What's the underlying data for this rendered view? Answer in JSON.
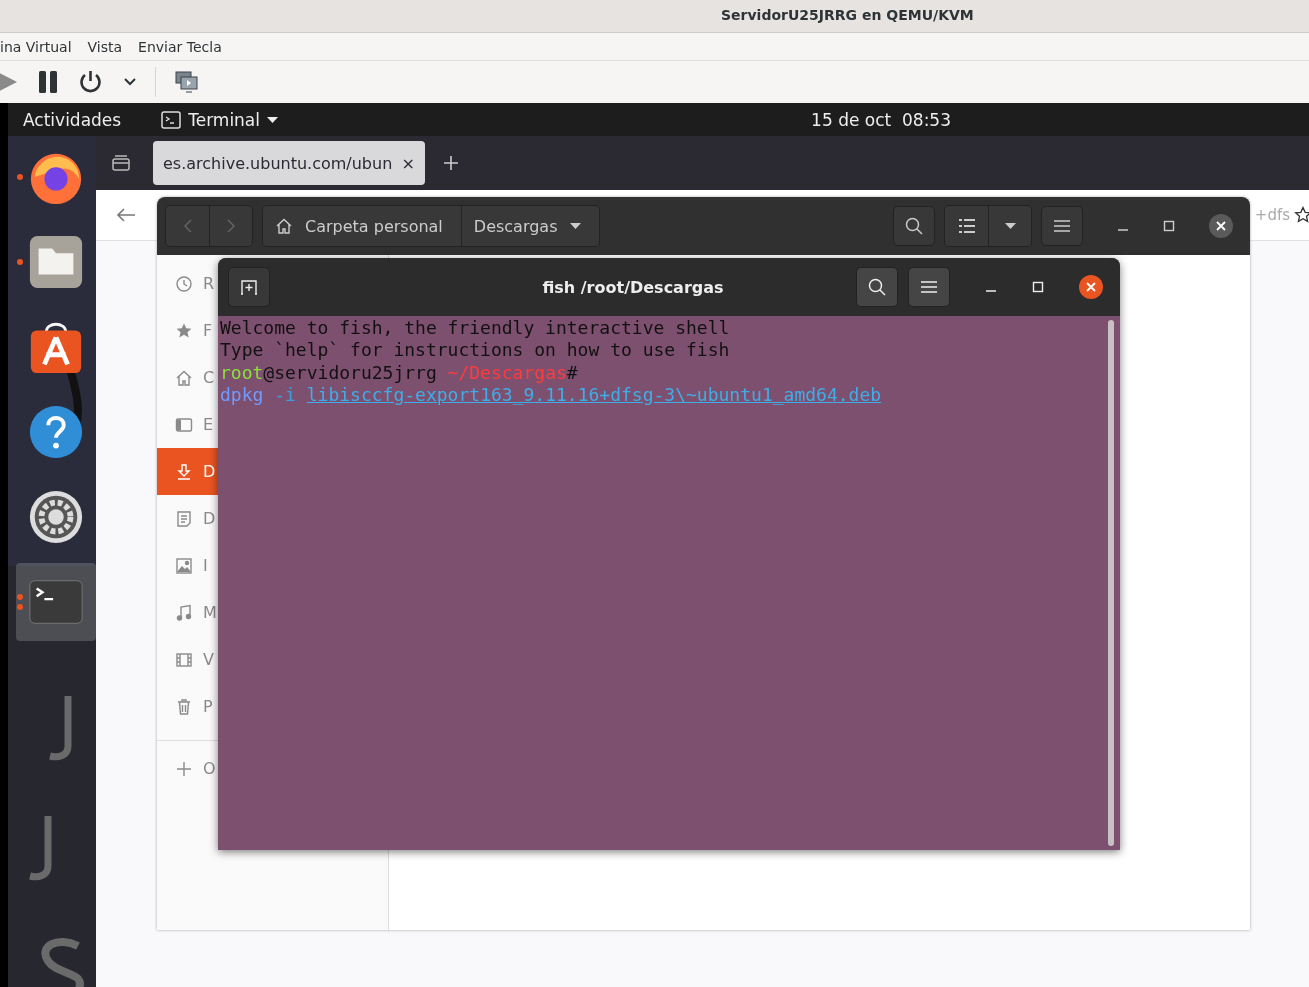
{
  "host_window": {
    "title": "ServidorU25JRRG en QEMU/KVM",
    "menu": [
      "ina Virtual",
      "Vista",
      "Enviar Tecla"
    ]
  },
  "top_bar": {
    "activities": "Actividades",
    "app_menu": "Terminal",
    "clock": "15 de oct  08:53"
  },
  "dock": {
    "items": [
      {
        "kind": "browser",
        "running": true,
        "multi": false,
        "selected": false
      },
      {
        "kind": "files",
        "running": true,
        "multi": false,
        "selected": false
      },
      {
        "kind": "store",
        "running": false,
        "selected": false
      },
      {
        "kind": "help",
        "running": false,
        "selected": false
      },
      {
        "kind": "settings",
        "running": false,
        "selected": false
      },
      {
        "kind": "terminal",
        "running": true,
        "multi": true,
        "selected": true
      }
    ]
  },
  "browser": {
    "tab": {
      "label": "es.archive.ubuntu.com/ubun",
      "close": "×"
    },
    "url_fragment": "+dfs"
  },
  "file_manager": {
    "path": [
      {
        "kind": "home",
        "label": "Carpeta personal"
      },
      {
        "kind": "current",
        "label": "Descargas"
      }
    ],
    "sidebar": [
      {
        "kind": "recent",
        "label": "R",
        "selected": false
      },
      {
        "kind": "starred",
        "label": "F",
        "selected": false
      },
      {
        "kind": "home",
        "label": "C",
        "selected": false
      },
      {
        "kind": "desktop",
        "label": "E",
        "selected": false
      },
      {
        "kind": "downloads",
        "label": "D",
        "selected": true
      },
      {
        "kind": "documents",
        "label": "D",
        "selected": false
      },
      {
        "kind": "pictures",
        "label": "I",
        "selected": false
      },
      {
        "kind": "music",
        "label": "M",
        "selected": false
      },
      {
        "kind": "videos",
        "label": "V",
        "selected": false
      },
      {
        "kind": "trash",
        "label": "P",
        "selected": false
      },
      {
        "kind": "other",
        "label": "O",
        "selected": false
      }
    ]
  },
  "terminal": {
    "title": "fish /root/Descargas",
    "lines": [
      {
        "kind": "plain",
        "text": "Welcome to fish, the friendly interactive shell"
      },
      {
        "kind": "plain",
        "text": "Type `help` for instructions on how to use fish"
      },
      {
        "kind": "prompt",
        "user": "root",
        "host": "@servidoru25jrrg",
        "cwd": "~/Descargas",
        "symbol": "#"
      },
      {
        "kind": "command",
        "command": "dpkg",
        "option": "-i",
        "argument": "libisccfg-export163_9.11.16+dfsg-3\\~ubuntu1_amd64.deb"
      }
    ]
  }
}
